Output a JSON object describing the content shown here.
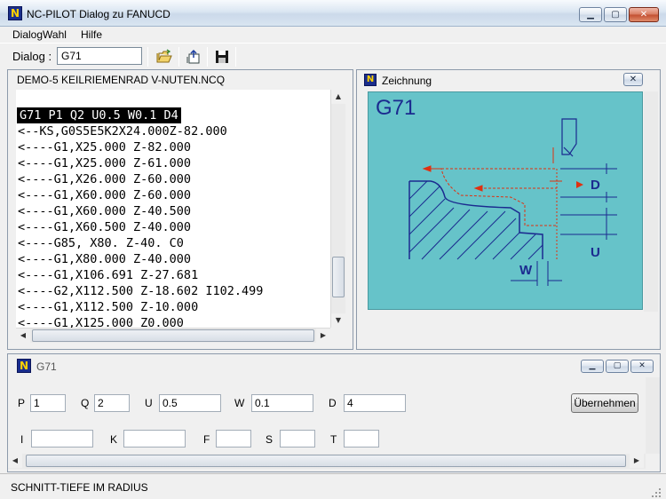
{
  "window": {
    "title": "NC-PILOT  Dialog zu FANUCD",
    "icon_letter": "N",
    "minimize": "▁",
    "maximize": "▢",
    "close": "✕"
  },
  "menu": {
    "items": [
      "DialogWahl",
      "Hilfe"
    ]
  },
  "toolbar": {
    "dialog_label": "Dialog :",
    "dialog_value": "G71",
    "icons": [
      "open-folder-icon",
      "export-icon",
      "save-icon"
    ]
  },
  "code_panel": {
    "title": "DEMO-5 KEILRIEMENRAD V-NUTEN.NCQ",
    "lines": [
      "G71 P1 Q2 U0.5 W0.1 D4",
      "<--KS,G0S5E5K2X24.000Z-82.000",
      "<----G1,X25.000 Z-82.000",
      "<----G1,X25.000 Z-61.000",
      "<----G1,X26.000 Z-60.000",
      "<----G1,X60.000 Z-60.000",
      "<----G1,X60.000 Z-40.500",
      "<----G1,X60.500 Z-40.000",
      "<----G85, X80. Z-40. C0",
      "<----G1,X80.000 Z-40.000",
      "<----G1,X106.691 Z-27.681",
      "<----G2,X112.500 Z-18.602 I102.499",
      "<----G1,X112.500 Z-10.000",
      "<----G1,X125.000 Z0.000"
    ]
  },
  "drawing_panel": {
    "title": "Zeichnung",
    "close": "✕",
    "heading": "G71",
    "label_d": "D",
    "label_u": "U",
    "label_w": "W",
    "colors": {
      "background": "#66c3c9",
      "dimension": "#1b2a8f",
      "path": "#e03010"
    }
  },
  "subdialog": {
    "title": "G71",
    "minimize": "▁",
    "maximize": "▢",
    "close": "✕",
    "row1": [
      {
        "label": "P",
        "value": "1"
      },
      {
        "label": "Q",
        "value": "2"
      },
      {
        "label": "U",
        "value": "0.5"
      },
      {
        "label": "W",
        "value": "0.1"
      },
      {
        "label": "D",
        "value": "4"
      }
    ],
    "row2": [
      {
        "label": "I",
        "value": ""
      },
      {
        "label": "K",
        "value": ""
      },
      {
        "label": "F",
        "value": ""
      },
      {
        "label": "S",
        "value": ""
      },
      {
        "label": "T",
        "value": ""
      }
    ],
    "apply_button": "Übernehmen"
  },
  "status": {
    "text": "SCHNITT-TIEFE IM RADIUS"
  }
}
